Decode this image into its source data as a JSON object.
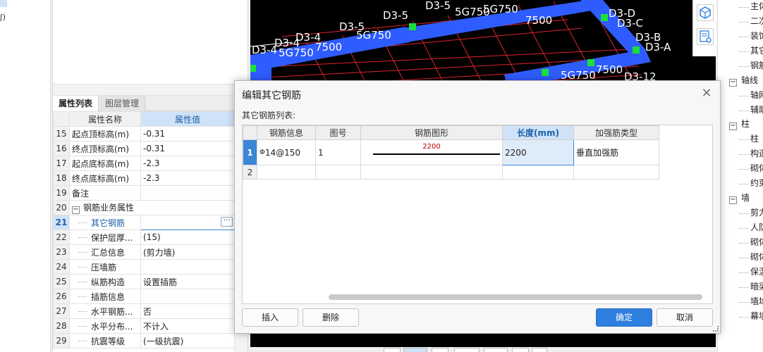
{
  "left_strip": {
    "fragment": "ʃ)"
  },
  "properties": {
    "tabs": [
      "属性列表",
      "图层管理"
    ],
    "headers": {
      "name": "属性名称",
      "value": "属性值"
    },
    "rows": [
      {
        "idx": "15",
        "name": "起点顶标高(m)",
        "value": "-0.31"
      },
      {
        "idx": "16",
        "name": "终点顶标高(m)",
        "value": "-0.31"
      },
      {
        "idx": "17",
        "name": "起点底标高(m)",
        "value": "-2.3"
      },
      {
        "idx": "18",
        "name": "终点底标高(m)",
        "value": "-2.3"
      },
      {
        "idx": "19",
        "name": "备注",
        "value": ""
      },
      {
        "idx": "20",
        "name": "钢筋业务属性",
        "value": ""
      },
      {
        "idx": "21",
        "name": "其它钢筋",
        "value": ""
      },
      {
        "idx": "22",
        "name": "保护层厚...",
        "value": "(15)"
      },
      {
        "idx": "23",
        "name": "汇总信息",
        "value": "(剪力墙)"
      },
      {
        "idx": "24",
        "name": "压墙筋",
        "value": ""
      },
      {
        "idx": "25",
        "name": "纵筋构造",
        "value": "设置插筋"
      },
      {
        "idx": "26",
        "name": "插筋信息",
        "value": ""
      },
      {
        "idx": "27",
        "name": "水平钢筋...",
        "value": "否"
      },
      {
        "idx": "28",
        "name": "水平分布...",
        "value": "不计入"
      },
      {
        "idx": "29",
        "name": "抗震等级",
        "value": "(一级抗震)"
      }
    ],
    "ellipsis": "···"
  },
  "viewport": {
    "labels": [
      "D3-4",
      "D3-4",
      "D3-4",
      "D3-5",
      "D3-5",
      "D3-5",
      "D3-D",
      "D3-C",
      "D3-B",
      "D3-A",
      "D3-12",
      "7500",
      "7500",
      "7500",
      "5G750",
      "5G750",
      "5G750",
      "5G750",
      "5G750"
    ]
  },
  "right_tree": {
    "groups": [
      {
        "label": "轴线",
        "children": [
          "轴网",
          "辅助"
        ]
      },
      {
        "label": "柱",
        "children": [
          "柱",
          "构造",
          "砌体",
          "约束"
        ]
      },
      {
        "label": "墙",
        "children": [
          "剪力",
          "人防",
          "砌体",
          "砌体",
          "保温",
          "暗梁",
          "墙垛",
          "幕墙"
        ]
      }
    ],
    "top_items": [
      "主体",
      "二次",
      "装饰",
      "其它",
      "钢筋"
    ]
  },
  "dialog": {
    "title": "编辑其它钢筋",
    "subtitle": "其它钢筋列表:",
    "columns": [
      "钢筋信息",
      "图号",
      "钢筋图形",
      "长度(mm)",
      "加强筋类型"
    ],
    "rows": [
      {
        "idx": "1",
        "info": "14@150",
        "info_prefix": "Φ",
        "fig": "1",
        "shape_value": "2200",
        "length": "2200",
        "type": "垂直加强筋"
      },
      {
        "idx": "2",
        "info": "",
        "info_prefix": "",
        "fig": "",
        "shape_value": "",
        "length": "",
        "type": ""
      }
    ],
    "buttons": {
      "insert": "插入",
      "delete": "删除",
      "ok": "确定",
      "cancel": "取消"
    },
    "close": "×"
  }
}
